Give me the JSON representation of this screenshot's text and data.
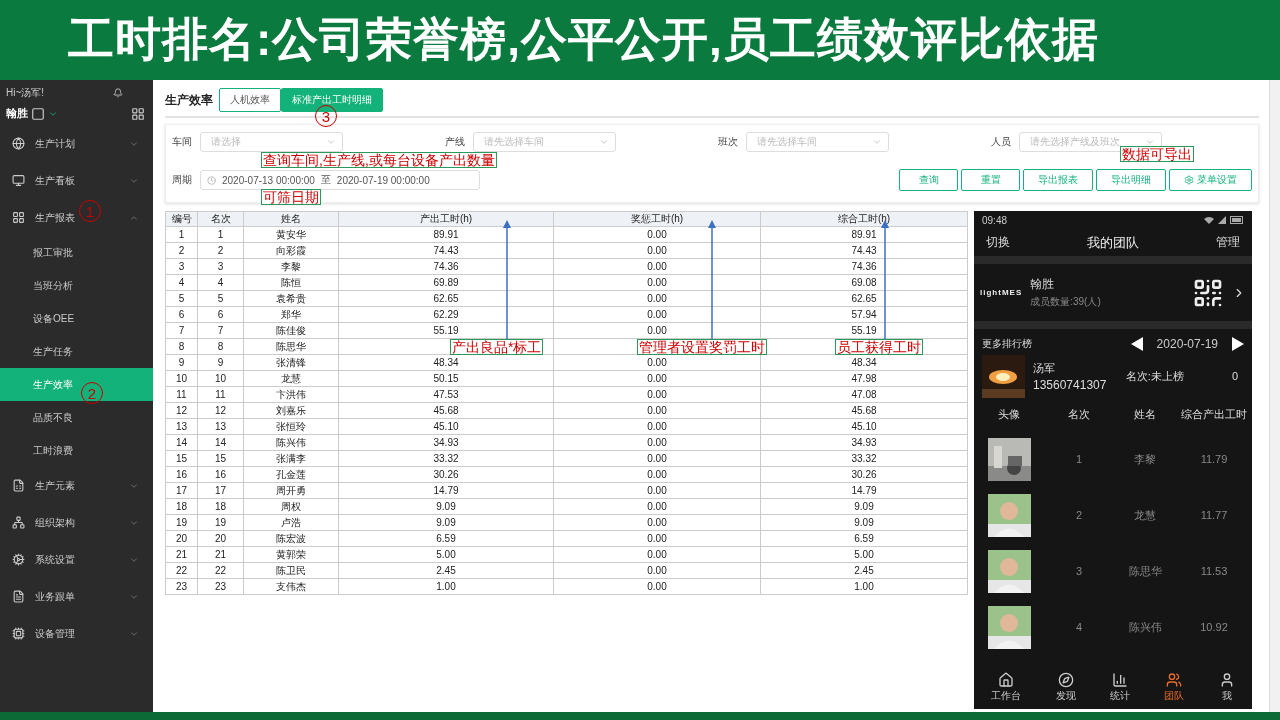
{
  "slide_title": "工时排名:公司荣誉榜,公平公开,员工绩效评比依据",
  "sidebar": {
    "greeting": "Hi~汤军!",
    "company": "翰胜",
    "items": [
      {
        "label": "生产计划",
        "expanded": false
      },
      {
        "label": "生产看板",
        "expanded": false
      },
      {
        "label": "生产报表",
        "expanded": true,
        "children": [
          {
            "label": "报工审批",
            "selected": false
          },
          {
            "label": "当班分析",
            "selected": false
          },
          {
            "label": "设备OEE",
            "selected": false
          },
          {
            "label": "生产任务",
            "selected": false
          },
          {
            "label": "生产效率",
            "selected": true
          },
          {
            "label": "品质不良",
            "selected": false
          },
          {
            "label": "工时浪费",
            "selected": false
          }
        ]
      },
      {
        "label": "生产元素",
        "expanded": false
      },
      {
        "label": "组织架构",
        "expanded": false
      },
      {
        "label": "系统设置",
        "expanded": false
      },
      {
        "label": "业务跟单",
        "expanded": false
      },
      {
        "label": "设备管理",
        "expanded": false
      }
    ]
  },
  "page": {
    "title": "生产效率",
    "tabs": [
      {
        "label": "人机效率",
        "selected": false
      },
      {
        "label": "标准产出工时明细",
        "selected": true
      }
    ]
  },
  "filters": [
    {
      "label": "车间",
      "placeholder": "请选择"
    },
    {
      "label": "产线",
      "placeholder": "请先选择车间"
    },
    {
      "label": "班次",
      "placeholder": "请先选择车间"
    },
    {
      "label": "人员",
      "placeholder": "请先选择产线及班次"
    }
  ],
  "period": {
    "label": "周期",
    "start": "2020-07-13 00:00:00",
    "separator": "至",
    "end": "2020-07-19 00:00:00"
  },
  "buttons": [
    {
      "label": "查询",
      "kind": "plain"
    },
    {
      "label": "重置",
      "kind": "plain"
    },
    {
      "label": "导出报表",
      "kind": "plain"
    },
    {
      "label": "导出明细",
      "kind": "plain"
    },
    {
      "label": "菜单设置",
      "kind": "settings"
    }
  ],
  "table": {
    "columns": [
      "编号",
      "名次",
      "姓名",
      "产出工时(h)",
      "奖惩工时(h)",
      "综合工时(h)"
    ],
    "rows": [
      [
        "1",
        "1",
        "黄安华",
        "89.91",
        "0.00",
        "89.91"
      ],
      [
        "2",
        "2",
        "向彩霞",
        "74.43",
        "0.00",
        "74.43"
      ],
      [
        "3",
        "3",
        "李黎",
        "74.36",
        "0.00",
        "74.36"
      ],
      [
        "4",
        "4",
        "陈恒",
        "69.89",
        "0.00",
        "69.08"
      ],
      [
        "5",
        "5",
        "袁希贵",
        "62.65",
        "0.00",
        "62.65"
      ],
      [
        "6",
        "6",
        "郑华",
        "62.29",
        "0.00",
        "57.94"
      ],
      [
        "7",
        "7",
        "陈佳俊",
        "55.19",
        "0.00",
        "55.19"
      ],
      [
        "8",
        "8",
        "陈思华",
        null,
        null,
        null
      ],
      [
        "9",
        "9",
        "张清锋",
        "48.34",
        "0.00",
        "48.34"
      ],
      [
        "10",
        "10",
        "龙慧",
        "50.15",
        "0.00",
        "47.98"
      ],
      [
        "11",
        "11",
        "卞洪伟",
        "47.53",
        "0.00",
        "47.08"
      ],
      [
        "12",
        "12",
        "刘嘉乐",
        "45.68",
        "0.00",
        "45.68"
      ],
      [
        "13",
        "13",
        "张恒玲",
        "45.10",
        "0.00",
        "45.10"
      ],
      [
        "14",
        "14",
        "陈兴伟",
        "34.93",
        "0.00",
        "34.93"
      ],
      [
        "15",
        "15",
        "张满李",
        "33.32",
        "0.00",
        "33.32"
      ],
      [
        "16",
        "16",
        "孔金莲",
        "30.26",
        "0.00",
        "30.26"
      ],
      [
        "17",
        "17",
        "周开勇",
        "14.79",
        "0.00",
        "14.79"
      ],
      [
        "18",
        "18",
        "周权",
        "9.09",
        "0.00",
        "9.09"
      ],
      [
        "19",
        "19",
        "卢浩",
        "9.09",
        "0.00",
        "9.09"
      ],
      [
        "20",
        "20",
        "陈宏波",
        "6.59",
        "0.00",
        "6.59"
      ],
      [
        "21",
        "21",
        "黄郭荣",
        "5.00",
        "0.00",
        "5.00"
      ],
      [
        "22",
        "22",
        "陈卫民",
        "2.45",
        "0.00",
        "2.45"
      ],
      [
        "23",
        "23",
        "支伟杰",
        "1.00",
        "0.00",
        "1.00"
      ]
    ]
  },
  "phone": {
    "time": "09:48",
    "left_action": "切换",
    "title": "我的团队",
    "right_action": "管理",
    "team": {
      "logo": "lightMES",
      "name": "翰胜",
      "members": "成员数量:39(人)"
    },
    "ranking_label": "更多排行榜",
    "date": "2020-07-19",
    "me": {
      "name": "汤军",
      "phone": "13560741307",
      "rank": "名次:未上榜",
      "hours": "0"
    },
    "columns": [
      "头像",
      "名次",
      "姓名",
      "综合产出工时"
    ],
    "rows": [
      {
        "rank": "1",
        "name": "李黎",
        "hours": "11.79",
        "kind": "scene"
      },
      {
        "rank": "2",
        "name": "龙慧",
        "hours": "11.77",
        "kind": "person"
      },
      {
        "rank": "3",
        "name": "陈思华",
        "hours": "11.53",
        "kind": "person"
      },
      {
        "rank": "4",
        "name": "陈兴伟",
        "hours": "10.92",
        "kind": "person"
      }
    ],
    "tabs": [
      {
        "label": "工作台",
        "selected": false
      },
      {
        "label": "发现",
        "selected": false
      },
      {
        "label": "统计",
        "selected": false
      },
      {
        "label": "团队",
        "selected": true
      },
      {
        "label": "我",
        "selected": false
      }
    ]
  },
  "annotations": [
    {
      "kind": "circle",
      "text": "1"
    },
    {
      "kind": "circle",
      "text": "2"
    },
    {
      "kind": "circle",
      "text": "3"
    },
    {
      "kind": "note",
      "text": "查询车间,生产线,或每台设备产出数量"
    },
    {
      "kind": "note",
      "text": "可筛日期"
    },
    {
      "kind": "note",
      "text": "数据可导出"
    },
    {
      "kind": "note",
      "text": "产出良品*标工"
    },
    {
      "kind": "note",
      "text": "管理者设置奖罚工时"
    },
    {
      "kind": "note",
      "text": "员工获得工时"
    }
  ]
}
